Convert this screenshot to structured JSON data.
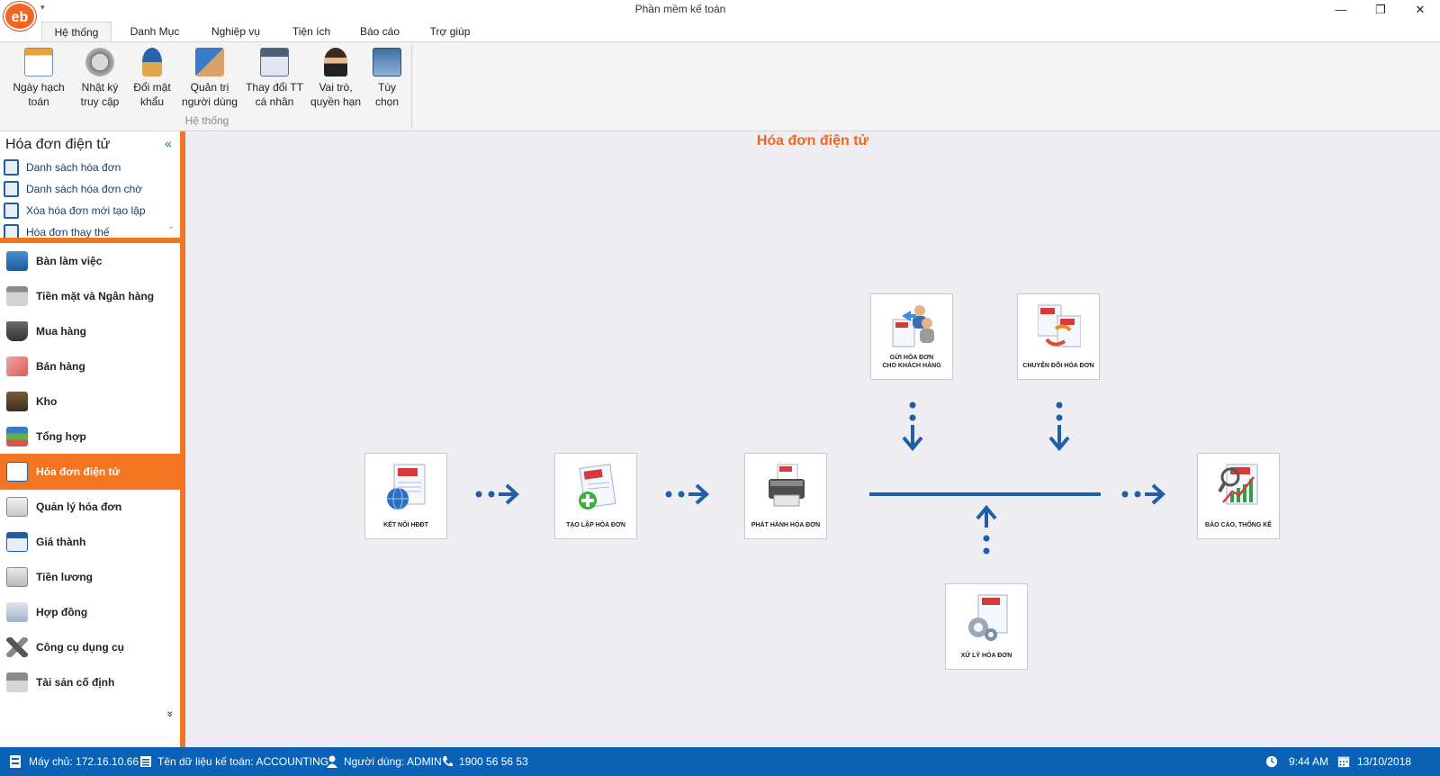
{
  "window": {
    "title": "Phần mềm kế toán",
    "logo_text": "eb",
    "qat_symbol": "▾",
    "minimize": "—",
    "restore": "❐",
    "close": "✕"
  },
  "ribbon": {
    "tabs": [
      "Hệ thống",
      "Danh Mục",
      "Nghiệp vụ",
      "Tiện ích",
      "Báo cáo",
      "Trợ giúp"
    ],
    "active_tab": "Hệ thống",
    "group_label": "Hệ thống",
    "buttons": [
      {
        "label": "Ngày hạch\ntoán",
        "icon": "calendar-icon"
      },
      {
        "label": "Nhật ký\ntruy cập",
        "icon": "hourglass-icon"
      },
      {
        "label": "Đổi mật\nkhẩu",
        "icon": "key-user-icon"
      },
      {
        "label": "Quản trị\nngười dùng",
        "icon": "admin-user-icon"
      },
      {
        "label": "Thay đổi TT\ncá nhân",
        "icon": "id-card-icon"
      },
      {
        "label": "Vai trò,\nquyền hạn",
        "icon": "role-user-icon"
      },
      {
        "label": "Tùy\nchọn",
        "icon": "settings-screen-icon"
      }
    ]
  },
  "sidebar": {
    "title": "Hóa đơn điện tử",
    "collapse_symbol": "«",
    "more_symbol": "»",
    "sub_items": [
      "Danh sách hóa đơn",
      "Danh sách hóa đơn chờ",
      "Xóa hóa đơn mới tạo lập",
      "Hóa đơn thay thế"
    ],
    "nav_items": [
      "Bàn làm việc",
      "Tiền mặt và Ngân hàng",
      "Mua hàng",
      "Bán hàng",
      "Kho",
      "Tổng hợp",
      "Hóa đơn điện tử",
      "Quản lý hóa đơn",
      "Giá thành",
      "Tiền lương",
      "Hợp đồng",
      "Công cụ dụng cụ",
      "Tài sản cố định"
    ],
    "active_nav": "Hóa đơn điện tử"
  },
  "main": {
    "title": "Hóa đơn điện tử",
    "tiles": {
      "connect": "KẾT NỐI HĐĐT",
      "create": "TẠO LẬP HÓA ĐƠN",
      "issue": "PHÁT HÀNH HÓA ĐƠN",
      "send": "GỬI HÓA ĐƠN\nCHO KHÁCH HÀNG",
      "convert": "CHUYỂN ĐỔI HÓA ĐƠN",
      "process": "XỬ LÝ HÓA ĐƠN",
      "report": "BÁO CÁO, THỐNG KÊ"
    },
    "doc_caption": "HÓA ĐƠN\nĐIỆN TỬ"
  },
  "status": {
    "server": "Máy chủ: 172.16.10.66",
    "database": "Tên dữ liệu kế toán: ACCOUNTING",
    "user": "Người dùng: ADMIN",
    "phone": "1900 56 56 53",
    "time": "9:44 AM",
    "date": "13/10/2018"
  },
  "colors": {
    "accent": "#f47521",
    "title_orange": "#f26522",
    "status_blue": "#0a62b6",
    "arrow_blue": "#1f5fa8"
  }
}
